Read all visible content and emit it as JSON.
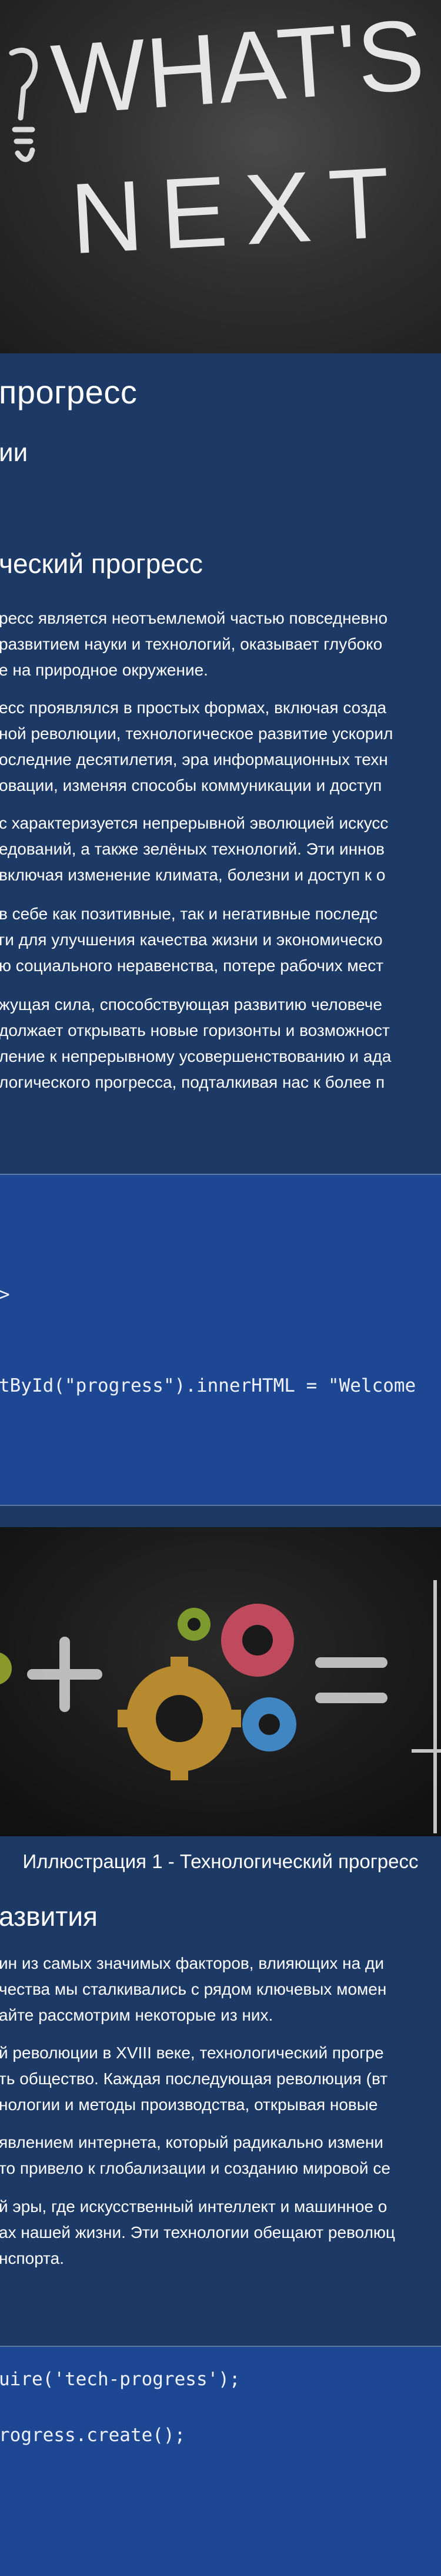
{
  "hero": {
    "chalk_line1": "WHAT'S",
    "chalk_line2": "NEXT"
  },
  "header": {
    "title": "прогресс",
    "subtitle": "ии"
  },
  "section1": {
    "heading": "ческий прогресс",
    "paragraphs": [
      [
        "ресс является неотъемлемой частью повседневно",
        "развитием науки и технологий, оказывает глубоко",
        "е на природное окружение."
      ],
      [
        "есс проявлялся в простых формах, включая созда",
        "ной революции, технологическое развитие ускорил",
        "оследние десятилетия, эра информационных техн",
        "овации, изменяя способы коммуникации и доступ"
      ],
      [
        "с характеризуется непрерывной эволюцией искусс",
        "едований, а также зелёных технологий. Эти иннов",
        "включая изменение климата, болезни и доступ к о"
      ],
      [
        "в себе как позитивные, так и негативные последс",
        "ги для улучшения качества жизни и экономическо",
        "ю социального неравенства, потере рабочих мест"
      ],
      [
        "жущая сила, способствующая развитию человече",
        "должает открывать новые горизонты и возможност",
        "ление к непрерывному усовершенствованию и ада",
        "логического прогресса, подталкивая нас к более п"
      ]
    ]
  },
  "code1": {
    "lines": [
      ">",
      "tById(\"progress\").innerHTML = \"Welcome"
    ]
  },
  "figure": {
    "caption": "Иллюстрация 1 - Технологический прогресс"
  },
  "section2": {
    "heading": "азвития",
    "paragraphs": [
      [
        "ин из самых значимых факторов, влияющих на ди",
        "чества мы сталкивались с рядом ключевых момен",
        "айте рассмотрим некоторые из них."
      ],
      [
        "й революции в XVIII веке, технологический прогре",
        "ть общество. Каждая последующая революция (вт",
        "нологии и методы производства, открывая новые"
      ],
      [
        "явлением интернета, который радикально измени",
        "то привело к глобализации и созданию мировой се"
      ],
      [
        "й эры, где искусственный интеллект и машинное о",
        "ах нашей жизни. Эти технологии обещают революц",
        "нспорта."
      ]
    ]
  },
  "code2": {
    "lines": [
      "uire('tech-progress');",
      "rogress.create();"
    ]
  }
}
